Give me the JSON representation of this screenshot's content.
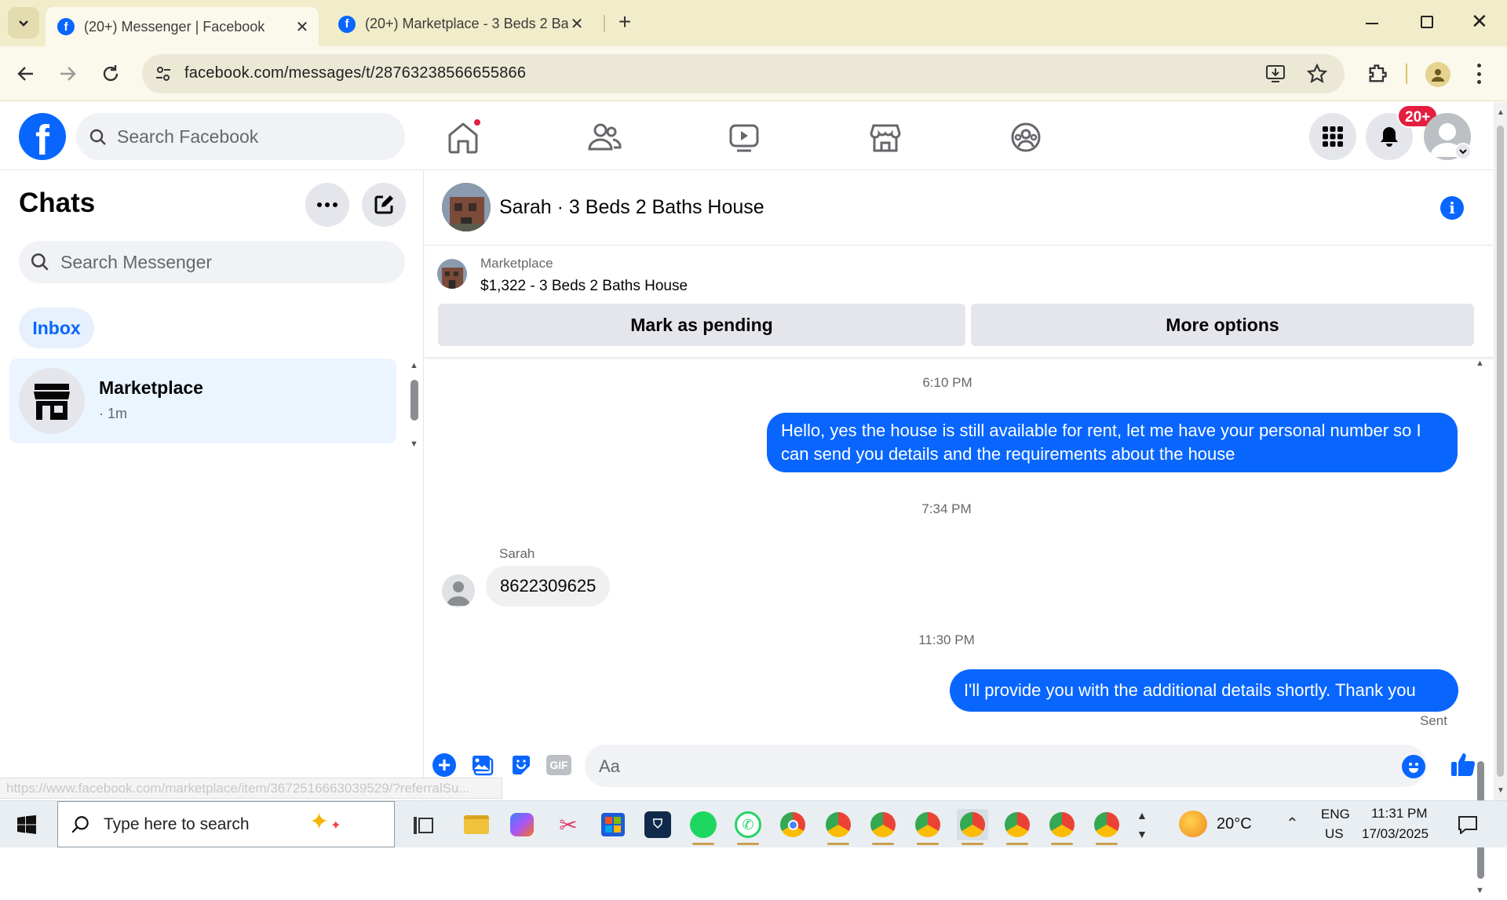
{
  "browser": {
    "tabs": [
      {
        "title": "(20+) Messenger | Facebook",
        "active": true
      },
      {
        "title": "(20+) Marketplace - 3 Beds 2 Ba",
        "active": false
      }
    ],
    "url": "facebook.com/messages/t/28763238566655866",
    "status_url": "https://www.facebook.com/marketplace/item/3672516663039529/?referralSu..."
  },
  "fb_header": {
    "search_placeholder": "Search Facebook",
    "notification_badge": "20+"
  },
  "sidebar": {
    "title": "Chats",
    "search_placeholder": "Search Messenger",
    "filter_inbox": "Inbox",
    "conversations": [
      {
        "name": "Marketplace",
        "meta": "· 1m"
      }
    ]
  },
  "chat": {
    "header_title": "Sarah · 3 Beds 2 Baths House",
    "listing": {
      "label": "Marketplace",
      "title": "$1,322 - 3 Beds 2 Baths House"
    },
    "mark_pending_label": "Mark as pending",
    "more_options_label": "More options",
    "messages": [
      {
        "type": "timestamp",
        "text": "6:10 PM"
      },
      {
        "type": "outgoing",
        "text": "Hello, yes the house is still available for rent, let me have your personal number so I can send you details and the requirements about the house"
      },
      {
        "type": "timestamp",
        "text": "7:34 PM"
      },
      {
        "type": "incoming",
        "sender": "Sarah",
        "text": "8622309625"
      },
      {
        "type": "timestamp",
        "text": "11:30 PM"
      },
      {
        "type": "outgoing",
        "text": "I'll provide you with the additional details shortly. Thank you",
        "status": "Sent"
      }
    ],
    "composer_placeholder": "Aa",
    "gif_label": "GIF"
  },
  "taskbar": {
    "search_placeholder": "Type here to search",
    "weather": "20°C",
    "lang_line1": "ENG",
    "lang_line2": "US",
    "time": "11:31 PM",
    "date": "17/03/2025"
  },
  "colors": {
    "fb_blue": "#0866ff",
    "badge_red": "#e41e3f",
    "tabstrip": "#f1ecc9"
  }
}
